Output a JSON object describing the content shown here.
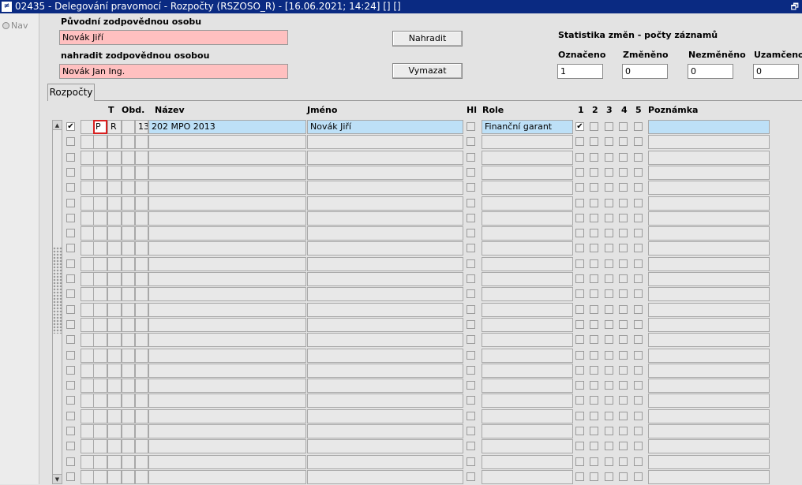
{
  "window": {
    "icon_text": "≠",
    "title": "02435 - Delegování pravomocí - Rozpočty (RSZOSO_R) - [16.06.2021; 14:24] [] []",
    "restore_glyph": "🗗"
  },
  "nav": {
    "label": "Nav"
  },
  "form": {
    "original_label": "Původní zodpovědnou osobu",
    "original_value": "Novák Jiří",
    "replace_label": "nahradit zodpovědnou osobou",
    "replace_value": "Novák Jan Ing.",
    "replace_button": "Nahradit",
    "clear_button": "Vymazat"
  },
  "stats": {
    "title": "Statistika změn - počty záznamů",
    "labels": [
      "Označeno",
      "Změněno",
      "Nezměněno",
      "Uzamčeno"
    ],
    "values": [
      "1",
      "0",
      "0",
      "0"
    ]
  },
  "tab": {
    "label": "Rozpočty"
  },
  "columns": {
    "t": "T",
    "obd": "Obd.",
    "nazev": "Název",
    "jmeno": "Jméno",
    "hl": "Hl",
    "role": "Role",
    "c1": "1",
    "c2": "2",
    "c3": "3",
    "c4": "4",
    "c5": "5",
    "poznamka": "Poznámka"
  },
  "rows": [
    {
      "checked": true,
      "p": "P",
      "t": "R",
      "obd": "13",
      "nazev": "202 MPO 2013",
      "jmeno": "Novák Jiří",
      "hl": false,
      "role": "Finanční garant",
      "c1": true,
      "c2": false,
      "c3": false,
      "c4": false,
      "c5": false,
      "poznamka": ""
    }
  ],
  "empty_row_count": 23,
  "colors": {
    "title_bar": "#0a2a82",
    "pink_field": "#ffc0c0",
    "active_row": "#bde0f7",
    "focus_border": "#d82020"
  }
}
